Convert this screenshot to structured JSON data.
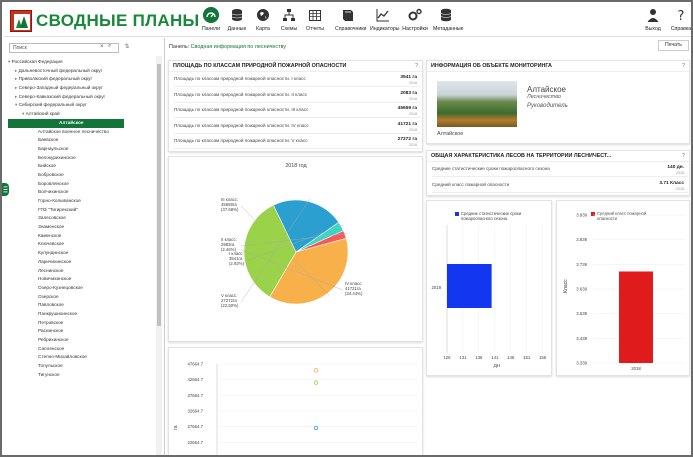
{
  "app": {
    "title": "СВОДНЫЕ ПЛАНЫ"
  },
  "nav": [
    {
      "label": "Панели",
      "icon": "dashboard-icon",
      "active": true
    },
    {
      "label": "Данные",
      "icon": "database-icon"
    },
    {
      "label": "Карта",
      "icon": "globe-icon"
    },
    {
      "label": "Схемы",
      "icon": "hierarchy-icon"
    },
    {
      "label": "Отчеты",
      "icon": "table-icon"
    },
    {
      "label": "Справочники",
      "icon": "book-icon"
    },
    {
      "label": "Индикаторы",
      "icon": "line-chart-icon"
    },
    {
      "label": "Настройки",
      "icon": "gears-icon"
    },
    {
      "label": "Метаданные",
      "icon": "stack-icon"
    },
    {
      "label": "Выход",
      "icon": "user-icon"
    },
    {
      "label": "Справка",
      "icon": "help-icon"
    }
  ],
  "sidebar": {
    "search_placeholder": "Поиск",
    "clear": "×",
    "search_glyph": "⌕",
    "collapse_glyph": "⇅",
    "tree": [
      {
        "label": "Российская Федерация",
        "depth": 0,
        "arrow": "▾"
      },
      {
        "label": "Дальневосточный федеральный округ",
        "depth": 1,
        "arrow": "▸"
      },
      {
        "label": "Приволжский федеральный округ",
        "depth": 1,
        "arrow": "▸"
      },
      {
        "label": "Северо-Западный федеральный округ",
        "depth": 1,
        "arrow": "▸"
      },
      {
        "label": "Северо-Кавказский федеральный округ",
        "depth": 1,
        "arrow": "▸"
      },
      {
        "label": "Сибирский федеральный округ",
        "depth": 1,
        "arrow": "▾"
      },
      {
        "label": "Алтайский край",
        "depth": 2,
        "arrow": "▾"
      },
      {
        "label": "Алтайское",
        "depth": 3,
        "arrow": "",
        "selected": true
      },
      {
        "label": "Алтайское военное лесничество",
        "depth": 3,
        "arrow": ""
      },
      {
        "label": "Баевское",
        "depth": 3,
        "arrow": ""
      },
      {
        "label": "Барнаульское",
        "depth": 3,
        "arrow": ""
      },
      {
        "label": "Белокурихинское",
        "depth": 3,
        "arrow": ""
      },
      {
        "label": "Бийское",
        "depth": 3,
        "arrow": ""
      },
      {
        "label": "Бобровское",
        "depth": 3,
        "arrow": ""
      },
      {
        "label": "Боровлянское",
        "depth": 3,
        "arrow": ""
      },
      {
        "label": "Волчихинское",
        "depth": 3,
        "arrow": ""
      },
      {
        "label": "Горно-Колыванское",
        "depth": 3,
        "arrow": ""
      },
      {
        "label": "ГПЗ \"Тигирекский\"",
        "depth": 3,
        "arrow": ""
      },
      {
        "label": "Залесовское",
        "depth": 3,
        "arrow": ""
      },
      {
        "label": "Знаменское",
        "depth": 3,
        "arrow": ""
      },
      {
        "label": "Каменское",
        "depth": 3,
        "arrow": ""
      },
      {
        "label": "Ключевское",
        "depth": 3,
        "arrow": ""
      },
      {
        "label": "Кулундинское",
        "depth": 3,
        "arrow": ""
      },
      {
        "label": "Ларичихинское",
        "depth": 3,
        "arrow": ""
      },
      {
        "label": "Леснинское",
        "depth": 3,
        "arrow": ""
      },
      {
        "label": "Новичихинское",
        "depth": 3,
        "arrow": ""
      },
      {
        "label": "Озеро-Кузнецовское",
        "depth": 3,
        "arrow": ""
      },
      {
        "label": "Озерское",
        "depth": 3,
        "arrow": ""
      },
      {
        "label": "Павловское",
        "depth": 3,
        "arrow": ""
      },
      {
        "label": "Панкрушихинское",
        "depth": 3,
        "arrow": ""
      },
      {
        "label": "Петровское",
        "depth": 3,
        "arrow": ""
      },
      {
        "label": "Раснинское",
        "depth": 3,
        "arrow": ""
      },
      {
        "label": "Ребрихинское",
        "depth": 3,
        "arrow": ""
      },
      {
        "label": "Сапленское",
        "depth": 3,
        "arrow": ""
      },
      {
        "label": "Степно-Михайловское",
        "depth": 3,
        "arrow": ""
      },
      {
        "label": "Топульское",
        "depth": 3,
        "arrow": ""
      },
      {
        "label": "Тигунское",
        "depth": 3,
        "arrow": ""
      }
    ]
  },
  "breadcrumb": {
    "prefix": "Панель:",
    "link": "Сводная информация по лесничеству"
  },
  "print_button": "Печать",
  "area_panel": {
    "title": "ПЛОЩАДЬ ПО КЛАССАМ ПРИРОДНОЙ ПОЖАРНОЙ ОПАСНОСТИ",
    "help": "?",
    "rows": [
      {
        "label": "Площадь по классам природной пожарной опасности. I класс",
        "value": "3541 га",
        "year": "2018"
      },
      {
        "label": "Площадь по классам природной пожарной опасности. II класс",
        "value": "2083 га",
        "year": "2018"
      },
      {
        "label": "Площадь по классам природной пожарной опасности. III класс",
        "value": "45659 га",
        "year": "2018"
      },
      {
        "label": "Площадь по классам природной пожарной опасности. IV класс",
        "value": "41721 га",
        "year": "2018"
      },
      {
        "label": "Площадь по классам природной пожарной опасности. V класс",
        "value": "27272 га",
        "year": "2018"
      }
    ]
  },
  "info_panel": {
    "title": "ИНФОРМАЦИЯ ОБ ОБЪЕКТЕ МОНИТОРИНГА",
    "help": "?",
    "name": "Алтайское",
    "type": "Лесничество",
    "role": "Руководитель",
    "caption": "Алтайское"
  },
  "char_panel": {
    "title": "ОБЩАЯ ХАРАКТЕРИСТИКА ЛЕСОВ НА ТЕРРИТОРИИ ЛЕСНИЧЕСТ...",
    "help": "?",
    "rows": [
      {
        "label": "Средние статистические сроки пожароопасного сезона",
        "value": "140 дн.",
        "year": "2018"
      },
      {
        "label": "Средний класс пожарной опасности",
        "value": "3.71 Класс",
        "year": "2018"
      }
    ]
  },
  "colors": {
    "accent": "#12763a",
    "title_green": "#19883a",
    "logo_red": "#c8321e"
  },
  "chart_data": [
    {
      "type": "pie",
      "title": "2018 год",
      "slices": [
        {
          "name": "III класс",
          "value": 45659,
          "label_lines": [
            "III класс:",
            "45659га",
            "(37.68%)"
          ],
          "color": "#f7b04a"
        },
        {
          "name": "IV класс",
          "value": 41721,
          "label_lines": [
            "IV класс:",
            "41721га",
            "(34.44%)"
          ],
          "color": "#9ad24a"
        },
        {
          "name": "V класс",
          "value": 27272,
          "label_lines": [
            "V класс:",
            "27272га",
            "(22.50%)"
          ],
          "color": "#2a9fd0"
        },
        {
          "name": "I класс",
          "value": 3541,
          "label_lines": [
            "I класс:",
            "3541га",
            "(2.92%)"
          ],
          "color": "#3ad6c6"
        },
        {
          "name": "II класс",
          "value": 2983,
          "label_lines": [
            "II класс:",
            "2983га",
            "(2.46%)"
          ],
          "color": "#f55a5a"
        }
      ]
    },
    {
      "type": "bar",
      "categories": [
        "2018"
      ],
      "series": [
        {
          "name": "Средние статистические сроки пожароопасного сезона",
          "values": [
            140
          ],
          "color": "#1337f0"
        }
      ],
      "xticks": [
        "126",
        "131",
        "136",
        "141",
        "146",
        "151",
        "156"
      ],
      "xlabel": "ДН",
      "xlim": [
        126,
        158
      ],
      "orientation": "horizontal"
    },
    {
      "type": "bar",
      "categories": [
        "2018"
      ],
      "series": [
        {
          "name": "Средний класс пожарной опасности",
          "values": [
            3.71
          ],
          "color": "#e01b1b"
        }
      ],
      "yticks": [
        "3.939",
        "3.839",
        "3.739",
        "3.639",
        "3.539",
        "3.439",
        "3.339"
      ],
      "ylabel": "Класс",
      "ylim": [
        3.339,
        3.939
      ]
    },
    {
      "type": "scatter",
      "yticks": [
        "47664.7",
        "42664.7",
        "37664.7",
        "32664.7",
        "27664.7",
        "22664.7",
        "17664.7"
      ],
      "ylabel": "га",
      "ylim": [
        17664.7,
        47664.7
      ],
      "points": [
        {
          "y": 45659,
          "color": "#f7b04a"
        },
        {
          "y": 41721,
          "color": "#9ad24a"
        },
        {
          "y": 27272,
          "color": "#2a9fd0"
        }
      ]
    }
  ]
}
